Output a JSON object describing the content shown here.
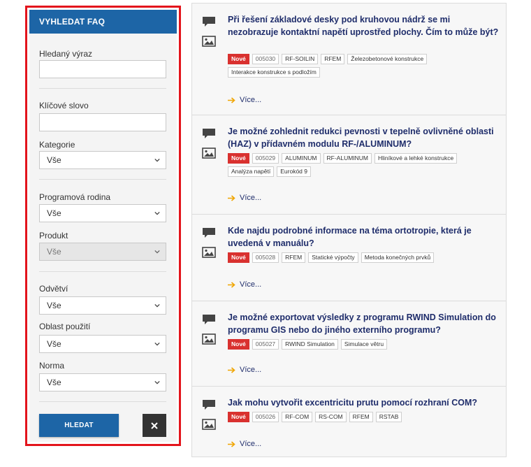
{
  "sidebar": {
    "title": "VYHLEDAT FAQ",
    "search_phrase": {
      "label": "Hledaný výraz",
      "value": ""
    },
    "keyword": {
      "label": "Klíčové slovo",
      "value": ""
    },
    "category": {
      "label": "Kategorie",
      "value": "Vše"
    },
    "program_family": {
      "label": "Programová rodina",
      "value": "Vše"
    },
    "product": {
      "label": "Produkt",
      "value": "Vše"
    },
    "industry": {
      "label": "Odvětví",
      "value": "Vše"
    },
    "application_area": {
      "label": "Oblast použití",
      "value": "Vše"
    },
    "standard": {
      "label": "Norma",
      "value": "Vše"
    },
    "search_button": "HLEDAT",
    "clear_icon": "close-icon"
  },
  "colors": {
    "accent": "#1d65a6",
    "title_text": "#1f2d6b",
    "new_badge": "#d9312f",
    "arrow": "#f0a500",
    "highlight_border": "#e3141c"
  },
  "faqs": [
    {
      "title": "Při řešení základové desky pod kruhovou nádrž se mi nezobrazuje kontaktní napětí uprostřed plochy. Čím to může být?",
      "badge": "Nové",
      "id": "005030",
      "tags": [
        "RF-SOILIN",
        "RFEM",
        "Železobetonové konstrukce",
        "Interakce konstrukce s podložím"
      ],
      "more": "Více..."
    },
    {
      "title": "Je možné zohlednit redukci pevnosti v tepelně ovlivněné oblasti (HAZ) v přídavném modulu RF-/ALUMINUM?",
      "badge": "Nové",
      "id": "005029",
      "tags": [
        "ALUMINUM",
        "RF-ALUMINUM",
        "Hliníkové a lehké konstrukce",
        "Analýza napětí",
        "Eurokód 9"
      ],
      "more": "Více..."
    },
    {
      "title": "Kde najdu podrobné informace na téma ortotropie, která je uvedená v manuálu?",
      "badge": "Nové",
      "id": "005028",
      "tags": [
        "RFEM",
        "Statické výpočty",
        "Metoda konečných prvků"
      ],
      "more": "Více..."
    },
    {
      "title": "Je možné exportovat výsledky z programu RWIND Simulation do programu GIS nebo do jiného externího programu?",
      "badge": "Nové",
      "id": "005027",
      "tags": [
        "RWIND Simulation",
        "Simulace větru"
      ],
      "more": "Více..."
    },
    {
      "title": "Jak mohu vytvořit excentricitu prutu pomocí rozhraní COM?",
      "badge": "Nové",
      "id": "005026",
      "tags": [
        "RF-COM",
        "RS-COM",
        "RFEM",
        "RSTAB"
      ],
      "more": "Více..."
    }
  ]
}
